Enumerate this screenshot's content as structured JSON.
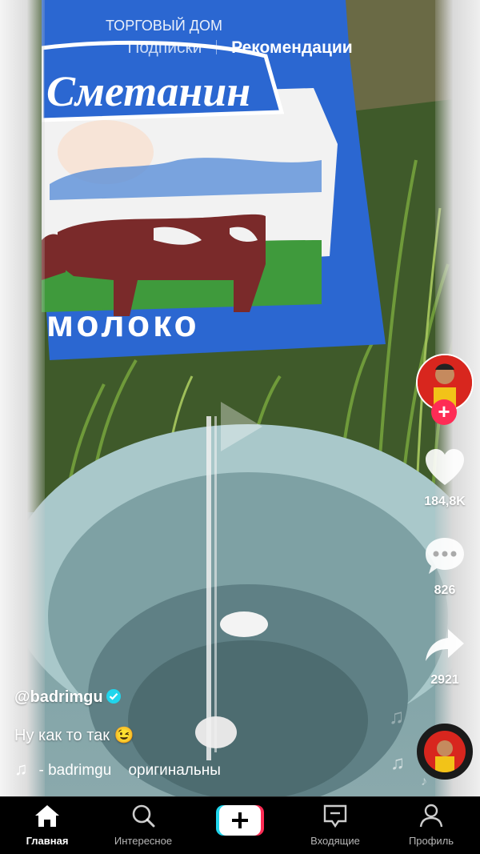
{
  "top_tabs": {
    "following": "Подписки",
    "for_you": "Рекомендации"
  },
  "creator": {
    "likes": "184,8K",
    "comments": "826",
    "shares": "2921"
  },
  "caption": {
    "username": "@badrimgu",
    "description": "Ну как то так 😉"
  },
  "music": {
    "artist": "- badrimgu",
    "title": "оригинальны"
  },
  "video_text": {
    "brand": "Сметанин",
    "product": "молоко",
    "top_line": "ТОРГОВЫЙ ДОМ"
  },
  "nav": {
    "home": "Главная",
    "discover": "Интересное",
    "inbox": "Входящие",
    "profile": "Профиль"
  },
  "colors": {
    "accent": "#fe2c55",
    "cyan": "#20d5ec",
    "bag_blue": "#2b67d1"
  },
  "icons": [
    "home-icon",
    "search-icon",
    "create-icon",
    "inbox-icon",
    "profile-icon",
    "heart-icon",
    "comment-icon",
    "share-icon",
    "music-note-icon",
    "play-icon",
    "verified-icon"
  ]
}
